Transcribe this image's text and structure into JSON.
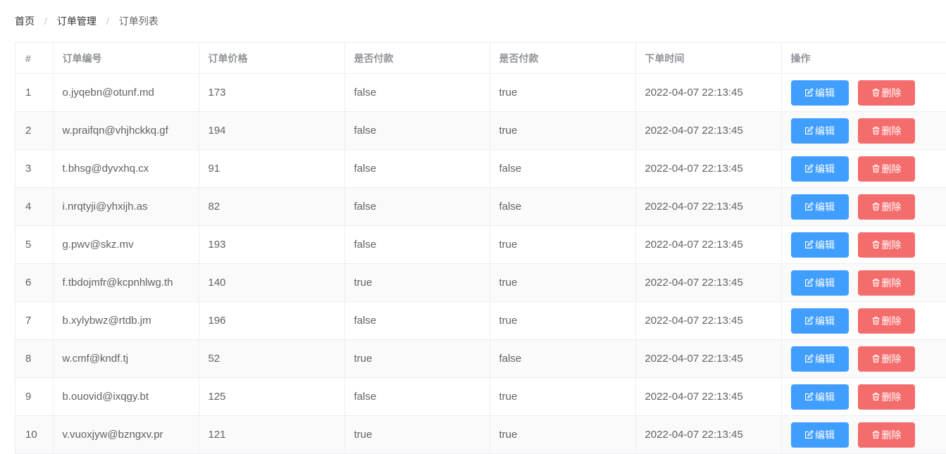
{
  "breadcrumb": [
    "首页",
    "订单管理",
    "订单列表"
  ],
  "table": {
    "headers": [
      "#",
      "订单编号",
      "订单价格",
      "是否付款",
      "是否付款",
      "下单时间",
      "操作"
    ],
    "edit_label": "编辑",
    "delete_label": "删除",
    "rows": [
      [
        "1",
        "o.jyqebn@otunf.md",
        "173",
        "false",
        "true",
        "2022-04-07 22:13:45"
      ],
      [
        "2",
        "w.praifqn@vhjhckkq.gf",
        "194",
        "false",
        "true",
        "2022-04-07 22:13:45"
      ],
      [
        "3",
        "t.bhsg@dyvxhq.cx",
        "91",
        "false",
        "false",
        "2022-04-07 22:13:45"
      ],
      [
        "4",
        "i.nrqtyji@yhxijh.as",
        "82",
        "false",
        "false",
        "2022-04-07 22:13:45"
      ],
      [
        "5",
        "g.pwv@skz.mv",
        "193",
        "false",
        "true",
        "2022-04-07 22:13:45"
      ],
      [
        "6",
        "f.tbdojmfr@kcpnhlwg.th",
        "140",
        "true",
        "true",
        "2022-04-07 22:13:45"
      ],
      [
        "7",
        "b.xylybwz@rtdb.jm",
        "196",
        "false",
        "true",
        "2022-04-07 22:13:45"
      ],
      [
        "8",
        "w.cmf@kndf.tj",
        "52",
        "true",
        "false",
        "2022-04-07 22:13:45"
      ],
      [
        "9",
        "b.ouovid@ixqgy.bt",
        "125",
        "false",
        "true",
        "2022-04-07 22:13:45"
      ],
      [
        "10",
        "v.vuoxjyw@bzngxv.pr",
        "121",
        "true",
        "true",
        "2022-04-07 22:13:45"
      ]
    ]
  },
  "colors": {
    "primary": "#409eff",
    "danger": "#f56c6c"
  },
  "icons": {
    "edit": "edit-icon",
    "delete": "trash-icon"
  }
}
